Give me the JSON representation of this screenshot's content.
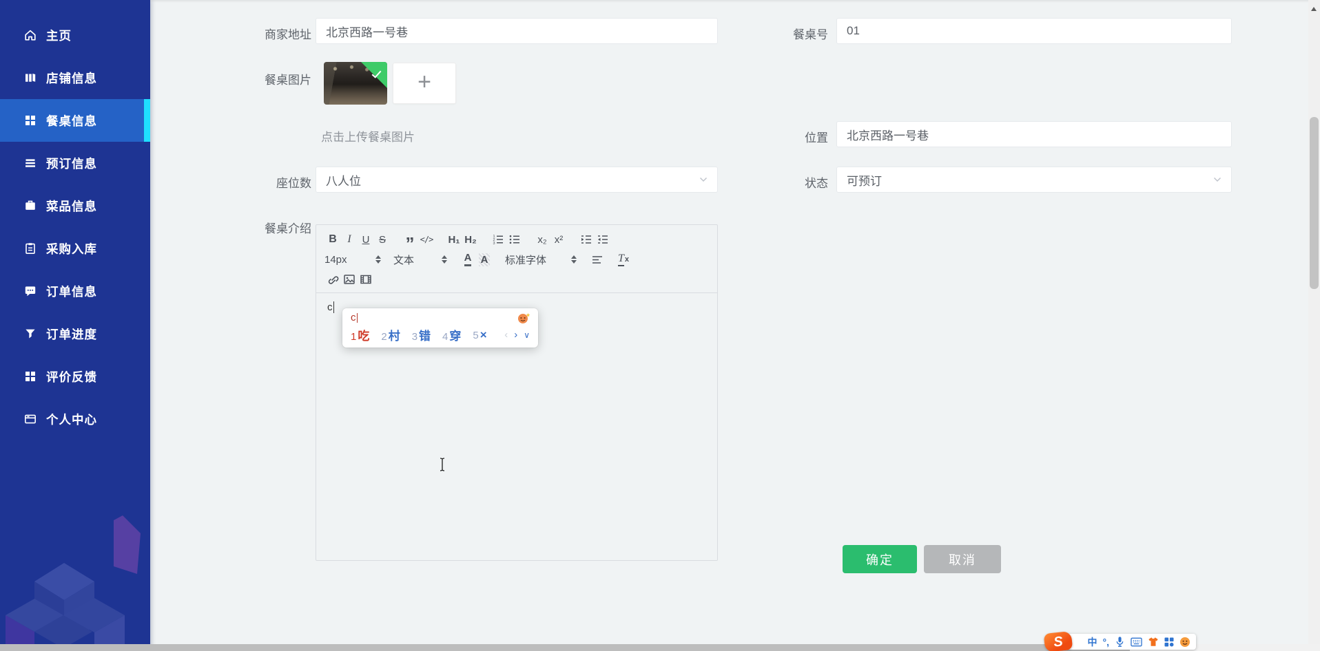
{
  "sidebar": {
    "items": [
      {
        "label": "主页",
        "icon": "home-icon",
        "active": false
      },
      {
        "label": "店铺信息",
        "icon": "shop-icon",
        "active": false
      },
      {
        "label": "餐桌信息",
        "icon": "table-grid-icon",
        "active": true
      },
      {
        "label": "预订信息",
        "icon": "reservation-list-icon",
        "active": false
      },
      {
        "label": "菜品信息",
        "icon": "dish-briefcase-icon",
        "active": false
      },
      {
        "label": "采购入库",
        "icon": "purchase-clipboard-icon",
        "active": false
      },
      {
        "label": "订单信息",
        "icon": "order-chat-icon",
        "active": false
      },
      {
        "label": "订单进度",
        "icon": "order-progress-funnel-icon",
        "active": false
      },
      {
        "label": "评价反馈",
        "icon": "feedback-grid-icon",
        "active": false
      },
      {
        "label": "个人中心",
        "icon": "profile-card-icon",
        "active": false
      }
    ]
  },
  "form": {
    "merchant_address": {
      "label": "商家地址",
      "value": "北京西路一号巷"
    },
    "table_no": {
      "label": "餐桌号",
      "value": "01"
    },
    "table_image": {
      "label": "餐桌图片",
      "upload_hint": "点击上传餐桌图片",
      "add_glyph": "+"
    },
    "location": {
      "label": "位置",
      "value": "北京西路一号巷"
    },
    "seats": {
      "label": "座位数",
      "value": "八人位"
    },
    "status": {
      "label": "状态",
      "value": "可预订"
    },
    "description": {
      "label": "餐桌介绍"
    }
  },
  "editor": {
    "content": "c",
    "toolbar": {
      "bold": "B",
      "italic": "I",
      "underline": "U",
      "strike": "S",
      "quote": "”",
      "code": "</>",
      "header1": "H₁",
      "header2": "H₂",
      "subscript": "x₂",
      "superscript": "x²",
      "size_value": "14px",
      "format_value": "文本",
      "font_value": "标准字体",
      "text_color": "A",
      "bg_color": "A",
      "clear_t": "T",
      "clear_x": "x"
    }
  },
  "ime": {
    "composition": "c",
    "candidates": [
      {
        "index": "1",
        "text": "吃"
      },
      {
        "index": "2",
        "text": "村"
      },
      {
        "index": "3",
        "text": "错"
      },
      {
        "index": "4",
        "text": "穿"
      },
      {
        "index": "5",
        "text": "×"
      }
    ],
    "prev_arrow": "‹",
    "next_arrow": "›",
    "expand_arrow": "∨"
  },
  "buttons": {
    "confirm": "确定",
    "cancel": "取消"
  },
  "sogou_bar": {
    "logo": "S",
    "mode_cn": "中",
    "punct": "°,"
  },
  "colors": {
    "sidebar_bg": "#1e3493",
    "sidebar_active_bg": "#2562c6",
    "active_indicator_cyan": "#1fdfff",
    "page_bg": "#f0f3f4",
    "confirm_green": "#2bbd6e",
    "cancel_gray": "#b5b7b9",
    "upload_badge_green": "#3ecb68",
    "ime_candidate_red": "#cf3a28",
    "ime_candidate_blue": "#386fc7",
    "sogou_orange": "#ef4a10",
    "sogou_blue": "#2f74d0"
  }
}
